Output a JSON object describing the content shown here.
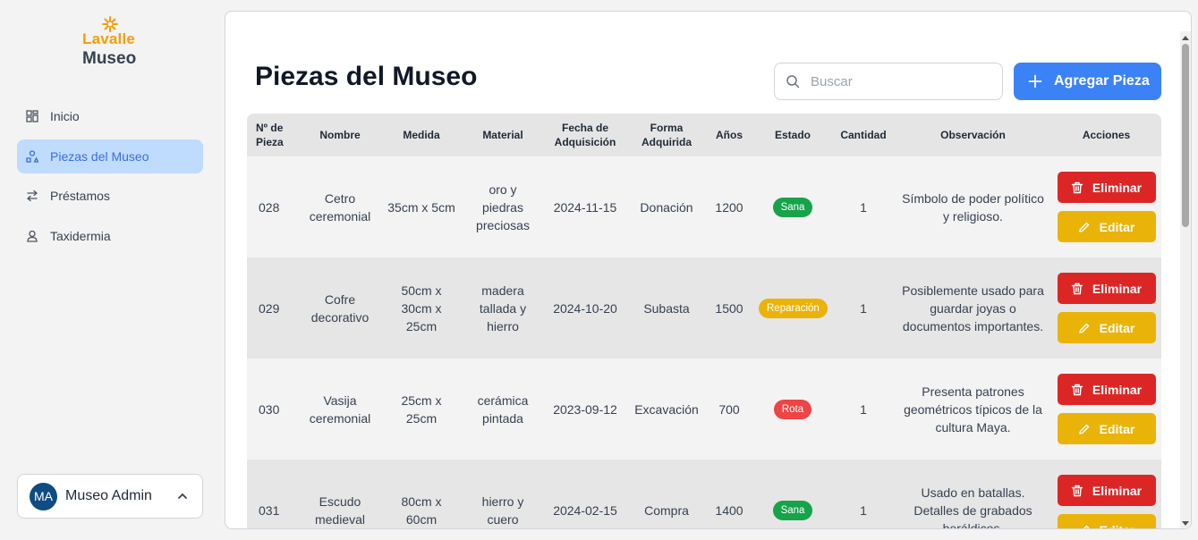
{
  "brand": {
    "line1": "Lavalle",
    "line2": "Museo"
  },
  "nav": [
    {
      "label": "Inicio",
      "icon": "grid-icon",
      "active": false
    },
    {
      "label": "Piezas del Museo",
      "icon": "shapes-icon",
      "active": true
    },
    {
      "label": "Préstamos",
      "icon": "arrows-exchange-icon",
      "active": false
    },
    {
      "label": "Taxidermia",
      "icon": "user-icon",
      "active": false
    }
  ],
  "user": {
    "initials": "MA",
    "name": "Museo Admin"
  },
  "page": {
    "title": "Piezas del Museo",
    "search_placeholder": "Buscar",
    "add_label": "Agregar Pieza"
  },
  "table": {
    "headers": [
      "Nº de Pieza",
      "Nombre",
      "Medida",
      "Material",
      "Fecha de Adquisición",
      "Forma Adquirida",
      "Años",
      "Estado",
      "Cantidad",
      "Observación",
      "Acciones"
    ],
    "rows": [
      {
        "num": "028",
        "nombre": "Cetro ceremonial",
        "medida": "35cm x 5cm",
        "material": "oro y piedras preciosas",
        "fecha": "2024-11-15",
        "forma": "Donación",
        "anios": "1200",
        "estado": "Sana",
        "cantidad": "1",
        "obs": "Símbolo de poder político y religioso."
      },
      {
        "num": "029",
        "nombre": "Cofre decorativo",
        "medida": "50cm x 30cm x 25cm",
        "material": "madera tallada y hierro",
        "fecha": "2024-10-20",
        "forma": "Subasta",
        "anios": "1500",
        "estado": "Reparación",
        "cantidad": "1",
        "obs": "Posiblemente usado para guardar joyas o documentos importantes."
      },
      {
        "num": "030",
        "nombre": "Vasija ceremonial",
        "medida": "25cm x 25cm",
        "material": "cerámica pintada",
        "fecha": "2023-09-12",
        "forma": "Excavación",
        "anios": "700",
        "estado": "Rota",
        "cantidad": "1",
        "obs": "Presenta patrones geométricos típicos de la cultura Maya."
      },
      {
        "num": "031",
        "nombre": "Escudo medieval",
        "medida": "80cm x 60cm",
        "material": "hierro y cuero",
        "fecha": "2024-02-15",
        "forma": "Compra",
        "anios": "1400",
        "estado": "Sana",
        "cantidad": "1",
        "obs": "Usado en batallas. Detalles de grabados heráldicos."
      }
    ],
    "delete_label": "Eliminar",
    "edit_label": "Editar"
  },
  "colors": {
    "brand_orange": "#f59e0b",
    "primary_blue": "#3b82f6",
    "active_nav_bg": "#bfdbfe",
    "delete_red": "#dc2626",
    "edit_yellow": "#eab308",
    "status_sana": "#16a34a",
    "status_reparacion": "#eab308",
    "status_rota": "#ef4444"
  }
}
